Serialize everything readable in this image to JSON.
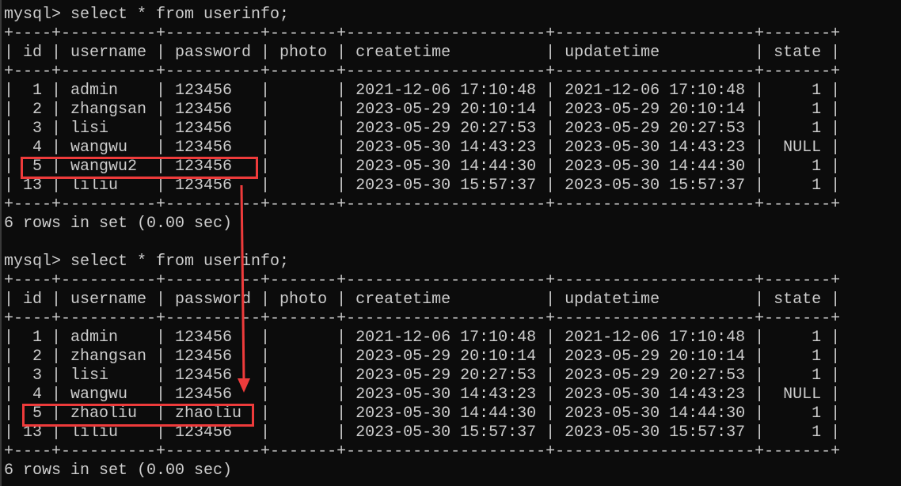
{
  "terminal": {
    "background": "#0c0c0c",
    "foreground": "#cccccc",
    "highlight_color": "#ee3b3b",
    "blocks": [
      {
        "prompt": "mysql> ",
        "command": "select * from userinfo;",
        "columns": [
          "id",
          "username",
          "password",
          "photo",
          "createtime",
          "updatetime",
          "state"
        ],
        "right_align": [
          true,
          false,
          false,
          false,
          false,
          false,
          true
        ],
        "rows": [
          [
            "1",
            "admin",
            "123456",
            "",
            "2021-12-06 17:10:48",
            "2021-12-06 17:10:48",
            "1"
          ],
          [
            "2",
            "zhangsan",
            "123456",
            "",
            "2023-05-29 20:10:14",
            "2023-05-29 20:10:14",
            "1"
          ],
          [
            "3",
            "lisi",
            "123456",
            "",
            "2023-05-29 20:27:53",
            "2023-05-29 20:27:53",
            "1"
          ],
          [
            "4",
            "wangwu",
            "123456",
            "",
            "2023-05-30 14:43:23",
            "2023-05-30 14:43:23",
            "NULL"
          ],
          [
            "5",
            "wangwu2",
            "123456",
            "",
            "2023-05-30 14:44:30",
            "2023-05-30 14:44:30",
            "1"
          ],
          [
            "13",
            "liliu",
            "123456",
            "",
            "2023-05-30 15:57:37",
            "2023-05-30 15:57:37",
            "1"
          ]
        ],
        "highlighted_row": 4,
        "footer": "6 rows in set (0.00 sec)"
      },
      {
        "prompt": "mysql> ",
        "command": "select * from userinfo;",
        "columns": [
          "id",
          "username",
          "password",
          "photo",
          "createtime",
          "updatetime",
          "state"
        ],
        "right_align": [
          true,
          false,
          false,
          false,
          false,
          false,
          true
        ],
        "rows": [
          [
            "1",
            "admin",
            "123456",
            "",
            "2021-12-06 17:10:48",
            "2021-12-06 17:10:48",
            "1"
          ],
          [
            "2",
            "zhangsan",
            "123456",
            "",
            "2023-05-29 20:10:14",
            "2023-05-29 20:10:14",
            "1"
          ],
          [
            "3",
            "lisi",
            "123456",
            "",
            "2023-05-29 20:27:53",
            "2023-05-29 20:27:53",
            "1"
          ],
          [
            "4",
            "wangwu",
            "123456",
            "",
            "2023-05-30 14:43:23",
            "2023-05-30 14:43:23",
            "NULL"
          ],
          [
            "5",
            "zhaoliu",
            "zhaoliu",
            "",
            "2023-05-30 14:44:30",
            "2023-05-30 14:44:30",
            "1"
          ],
          [
            "13",
            "liliu",
            "123456",
            "",
            "2023-05-30 15:57:37",
            "2023-05-30 15:57:37",
            "1"
          ]
        ],
        "highlighted_row": 4,
        "footer": "6 rows in set (0.00 sec)"
      }
    ]
  }
}
